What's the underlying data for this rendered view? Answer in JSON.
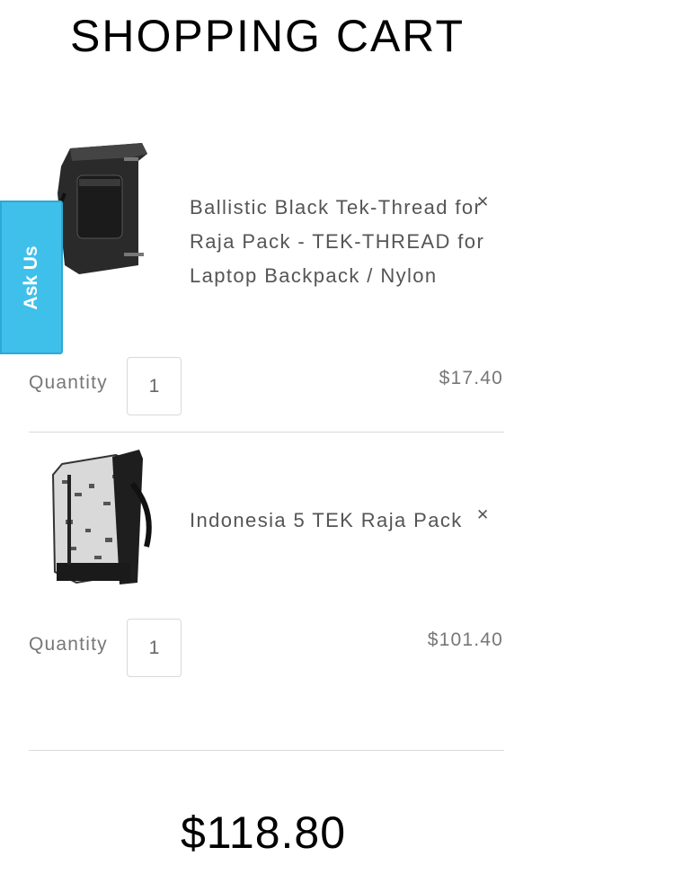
{
  "page": {
    "title": "SHOPPING CART"
  },
  "cart": {
    "items": [
      {
        "name": "Ballistic Black Tek-Thread for Raja Pack - TEK-THREAD for Laptop Backpack / Nylon",
        "quantity_label": "Quantity",
        "quantity": "1",
        "price": "$17.40",
        "remove_icon": "close-icon"
      },
      {
        "name": "Indonesia 5 TEK Raja Pack",
        "quantity_label": "Quantity",
        "quantity": "1",
        "price": "$101.40",
        "remove_icon": "close-icon"
      }
    ],
    "total": "$118.80"
  },
  "ask_us": {
    "label": "Ask Us",
    "color": "#3fc0ea"
  }
}
